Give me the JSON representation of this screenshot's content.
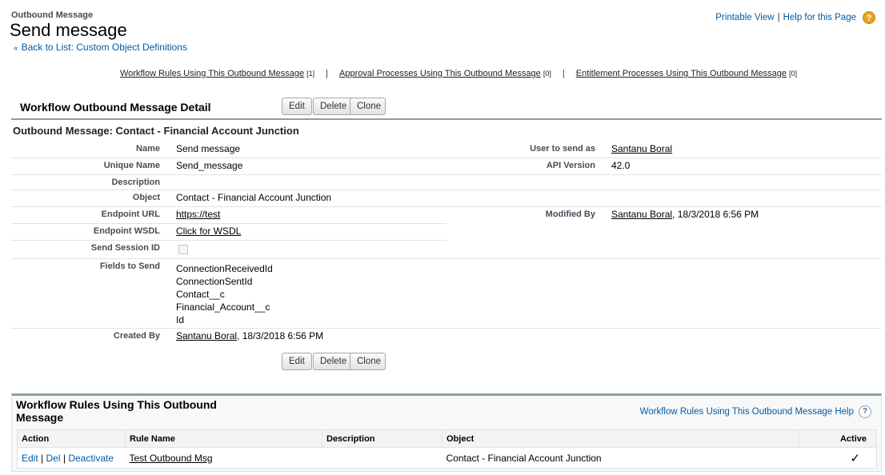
{
  "header": {
    "page_type": "Outbound Message",
    "page_title": "Send message",
    "back_link": "Back to List: Custom Object Definitions",
    "printable_view": "Printable View",
    "sep": "|",
    "help_link": "Help for this Page",
    "help_glyph": "?"
  },
  "related_links": [
    {
      "label": "Workflow Rules Using This Outbound Message",
      "count": "[1]"
    },
    {
      "label": "Approval Processes Using This Outbound Message",
      "count": "[0]"
    },
    {
      "label": "Entitlement Processes Using This Outbound Message",
      "count": "[0]"
    }
  ],
  "detail": {
    "title": "Workflow Outbound Message Detail",
    "buttons": {
      "edit": "Edit",
      "delete": "Delete",
      "clone": "Clone"
    },
    "section_title": "Outbound Message: Contact - Financial Account Junction",
    "fields": {
      "name": {
        "label": "Name",
        "value": "Send message"
      },
      "unique_name": {
        "label": "Unique Name",
        "value": "Send_message"
      },
      "description": {
        "label": "Description",
        "value": ""
      },
      "object": {
        "label": "Object",
        "value": "Contact - Financial Account Junction"
      },
      "endpoint_url": {
        "label": "Endpoint URL",
        "value": "https://test"
      },
      "endpoint_wsdl": {
        "label": "Endpoint WSDL",
        "value": "Click for WSDL"
      },
      "send_session_id": {
        "label": "Send Session ID",
        "checked": false
      },
      "fields_to_send": {
        "label": "Fields to Send",
        "values": [
          "ConnectionReceivedId",
          "ConnectionSentId",
          "Contact__c",
          "Financial_Account__c",
          "Id"
        ]
      },
      "created_by": {
        "label": "Created By",
        "user": "Santanu Boral",
        "date": ", 18/3/2018 6:56 PM"
      },
      "user_to_send_as": {
        "label": "User to send as",
        "value": "Santanu Boral"
      },
      "api_version": {
        "label": "API Version",
        "value": "42.0"
      },
      "modified_by": {
        "label": "Modified By",
        "user": "Santanu Boral",
        "date": ", 18/3/2018 6:56 PM"
      }
    }
  },
  "related_list": {
    "title": "Workflow Rules Using This Outbound Message",
    "help_link": "Workflow Rules Using This Outbound Message Help",
    "help_glyph": "?",
    "columns": [
      "Action",
      "Rule Name",
      "Description",
      "Object",
      "Active"
    ],
    "rows": [
      {
        "action_edit": "Edit",
        "action_del": "Del",
        "action_deactivate": "Deactivate",
        "sep": "|",
        "rule_name": "Test Outbound Msg",
        "description": "",
        "object": "Contact - Financial Account Junction",
        "active": "✓"
      }
    ]
  }
}
